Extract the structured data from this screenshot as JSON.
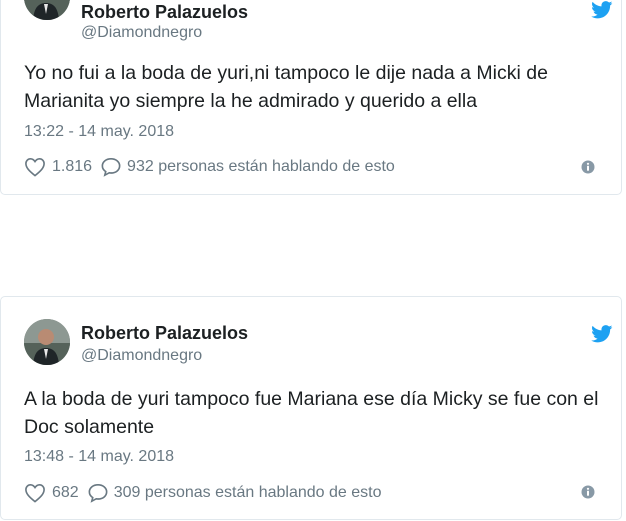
{
  "tweets": [
    {
      "name": "Roberto Palazuelos",
      "handle": "@Diamondnegro",
      "text": "Yo no fui a la boda de yuri,ni tampoco le dije nada a Micki de Marianita yo siempre la he admirado y querido a ella",
      "timestamp": "13:22 - 14 may. 2018",
      "likes": "1.816",
      "replies": "932 personas están hablando de esto"
    },
    {
      "name": "Roberto Palazuelos",
      "handle": "@Diamondnegro",
      "text": "A la boda de yuri tampoco fue Mariana ese día Micky se fue con el Doc solamente",
      "timestamp": "13:48 - 14 may. 2018",
      "likes": "682",
      "replies": "309 personas están hablando de esto"
    }
  ],
  "icons": {
    "brand": "twitter-bird-icon",
    "like": "heart-icon",
    "reply": "speech-bubble-icon",
    "info": "info-icon"
  },
  "colors": {
    "twitter_blue": "#1da1f2",
    "text": "#1c2022",
    "muted": "#697882",
    "border": "#e1e8ed"
  }
}
